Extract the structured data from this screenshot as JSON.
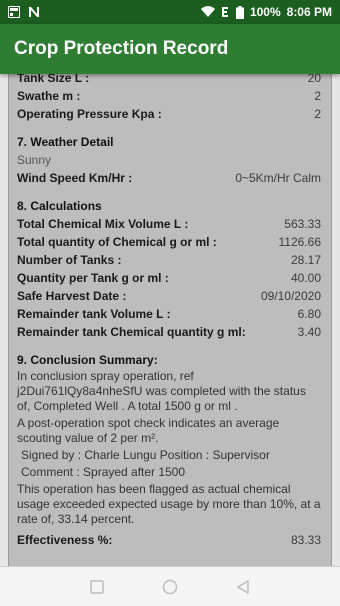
{
  "status_bar": {
    "left_icons": [
      "gallery-icon",
      "n-icon"
    ],
    "right_icons": [
      "wifi-icon",
      "data-e-icon",
      "battery-icon"
    ],
    "battery": "100%",
    "time": "8:06 PM"
  },
  "app_bar": {
    "title": "Crop Protection Record"
  },
  "tank": [
    {
      "label": "Tank Size L :",
      "value": "20"
    },
    {
      "label": "Swathe m :",
      "value": "2"
    },
    {
      "label": "Operating Pressure Kpa :",
      "value": "2"
    }
  ],
  "weather": {
    "heading": "7. Weather Detail",
    "condition": "Sunny",
    "wind_label": "Wind Speed Km/Hr :",
    "wind_value": "0~5Km/Hr Calm"
  },
  "calculations": {
    "heading": "8. Calculations",
    "rows": [
      {
        "label": "Total Chemical Mix Volume L :",
        "value": "563.33"
      },
      {
        "label": "Total quantity of Chemical g or ml :",
        "value": "1126.66"
      },
      {
        "label": "Number of Tanks :",
        "value": "28.17"
      },
      {
        "label": "Quantity per Tank g or ml :",
        "value": "40.00"
      },
      {
        "label": "Safe Harvest Date :",
        "value": "09/10/2020"
      },
      {
        "label": "Remainder tank Volume L :",
        "value": "6.80"
      },
      {
        "label": "Remainder tank Chemical quantity g ml:",
        "value": "3.40"
      }
    ]
  },
  "conclusion": {
    "heading": "9. Conclusion Summary:",
    "para1": "In conclusion spray operation, ref j2Dui761lQy8a4nheSfU was completed with the status of, Completed Well . A total 1500 g or ml .",
    "para2": "A post-operation spot check indicates an average scouting value of 2 per m².",
    "signed": "Signed by : Charle Lungu Position : Supervisor",
    "comment": "Comment : Sprayed after 1500",
    "para3": "This operation has been flagged as actual chemical usage exceeded expected usage by more than 10%, at a rate of, 33.14 percent.",
    "effectiveness_label": "Effectiveness %:",
    "effectiveness_value": "83.33"
  },
  "nav": [
    "recents-square-icon",
    "home-circle-icon",
    "back-triangle-icon"
  ]
}
